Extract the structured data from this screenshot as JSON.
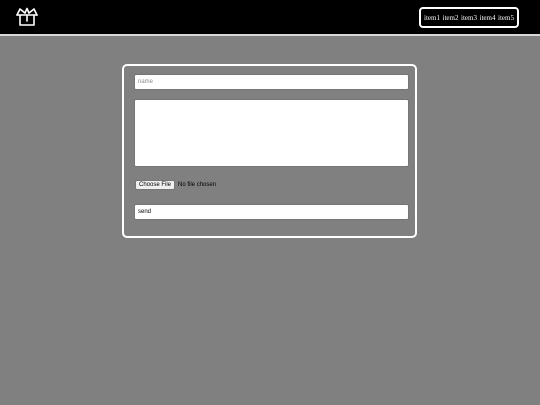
{
  "navbar": {
    "logo_icon": "open-box-icon",
    "items": [
      {
        "label": "item1"
      },
      {
        "label": "item2"
      },
      {
        "label": "item3"
      },
      {
        "label": "item4"
      },
      {
        "label": "item5"
      }
    ]
  },
  "form": {
    "name_placeholder": "name",
    "name_value": "",
    "message_value": "",
    "file_button_label": "Choose File",
    "file_status": "No file chosen",
    "submit_label": "send"
  },
  "colors": {
    "navbar_bg": "#000000",
    "page_bg": "#808080",
    "border": "#ffffff"
  }
}
